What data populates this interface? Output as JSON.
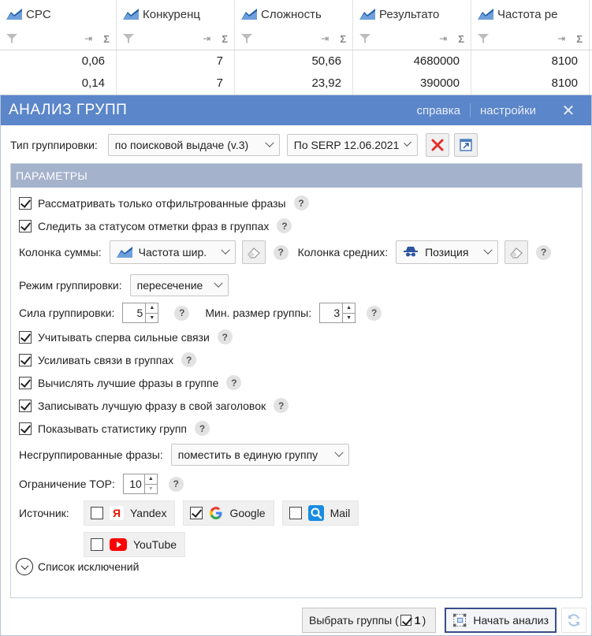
{
  "table": {
    "columns": [
      {
        "title": "CPC"
      },
      {
        "title": "Конкуренц"
      },
      {
        "title": "Сложность"
      },
      {
        "title": "Результато"
      },
      {
        "title": "Частота ре"
      }
    ],
    "sigma": "Σ",
    "rows": [
      [
        "0,06",
        "7",
        "50,66",
        "4680000",
        "8100"
      ],
      [
        "0,14",
        "7",
        "23,92",
        "390000",
        "8100"
      ]
    ]
  },
  "dialog": {
    "title": "АНАЛИЗ ГРУПП",
    "help_link": "справка",
    "settings_link": "настройки",
    "close_glyph": "✕"
  },
  "grouping": {
    "type_label": "Тип группировки:",
    "type_value": "по поисковой выдаче (v.3)",
    "serp_value": "По SERP 12.06.2021"
  },
  "params": {
    "header": "ПАРАМЕТРЫ",
    "only_filtered": {
      "label": "Рассматривать только отфильтрованные фразы",
      "checked": true
    },
    "track_status": {
      "label": "Следить за статусом отметки фраз в группах",
      "checked": true
    },
    "sum_column_label": "Колонка суммы:",
    "sum_column_value": "Частота шир.",
    "avg_column_label": "Колонка средних:",
    "avg_column_value": "Позиция",
    "mode_label": "Режим группировки:",
    "mode_value": "пересечение",
    "strength_label": "Сила группировки:",
    "strength_value": "5",
    "min_size_label": "Мин. размер группы:",
    "min_size_value": "3",
    "strong_first": {
      "label": "Учитывать сперва сильные связи",
      "checked": true
    },
    "strengthen": {
      "label": "Усиливать связи в группах",
      "checked": true
    },
    "best_phrases": {
      "label": "Вычислять лучшие фразы в группе",
      "checked": true
    },
    "write_best": {
      "label": "Записывать лучшую фразу в свой заголовок",
      "checked": true
    },
    "show_stats": {
      "label": "Показывать статистику групп",
      "checked": true
    },
    "ungrouped_label": "Несгруппированные фразы:",
    "ungrouped_value": "поместить в единую группу",
    "top_label": "Ограничение TOP:",
    "top_value": "10",
    "source_label": "Источник:",
    "sources": [
      {
        "name": "Yandex",
        "checked": false,
        "icon": "yandex-icon",
        "color": "#e61400"
      },
      {
        "name": "Google",
        "checked": true,
        "icon": "google-icon",
        "color": "#4285f4"
      },
      {
        "name": "Mail",
        "checked": false,
        "icon": "mail-search-icon",
        "color": "#168de2"
      },
      {
        "name": "YouTube",
        "checked": false,
        "icon": "youtube-icon",
        "color": "#ff0000"
      }
    ],
    "exclusions_label": "Список исключений",
    "help_glyph": "?"
  },
  "footer": {
    "select_groups_label": "Выбрать группы (",
    "select_groups_count": "1",
    "select_groups_close": ")",
    "start_label": "Начать анализ"
  },
  "colors": {
    "titlebar": "#5b86c9",
    "params_header": "#a4b2cc",
    "primary_border": "#3a4d8a"
  }
}
